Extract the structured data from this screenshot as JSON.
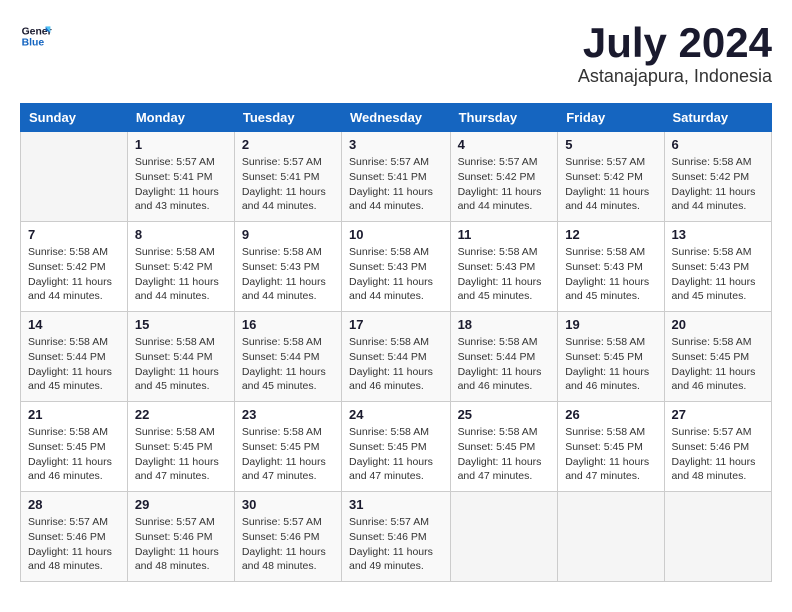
{
  "logo": {
    "line1": "General",
    "line2": "Blue"
  },
  "calendar": {
    "title": "July 2024",
    "subtitle": "Astanajapura, Indonesia"
  },
  "weekdays": [
    "Sunday",
    "Monday",
    "Tuesday",
    "Wednesday",
    "Thursday",
    "Friday",
    "Saturday"
  ],
  "weeks": [
    [
      {
        "day": "",
        "info": ""
      },
      {
        "day": "1",
        "info": "Sunrise: 5:57 AM\nSunset: 5:41 PM\nDaylight: 11 hours\nand 43 minutes."
      },
      {
        "day": "2",
        "info": "Sunrise: 5:57 AM\nSunset: 5:41 PM\nDaylight: 11 hours\nand 44 minutes."
      },
      {
        "day": "3",
        "info": "Sunrise: 5:57 AM\nSunset: 5:41 PM\nDaylight: 11 hours\nand 44 minutes."
      },
      {
        "day": "4",
        "info": "Sunrise: 5:57 AM\nSunset: 5:42 PM\nDaylight: 11 hours\nand 44 minutes."
      },
      {
        "day": "5",
        "info": "Sunrise: 5:57 AM\nSunset: 5:42 PM\nDaylight: 11 hours\nand 44 minutes."
      },
      {
        "day": "6",
        "info": "Sunrise: 5:58 AM\nSunset: 5:42 PM\nDaylight: 11 hours\nand 44 minutes."
      }
    ],
    [
      {
        "day": "7",
        "info": "Sunrise: 5:58 AM\nSunset: 5:42 PM\nDaylight: 11 hours\nand 44 minutes."
      },
      {
        "day": "8",
        "info": "Sunrise: 5:58 AM\nSunset: 5:42 PM\nDaylight: 11 hours\nand 44 minutes."
      },
      {
        "day": "9",
        "info": "Sunrise: 5:58 AM\nSunset: 5:43 PM\nDaylight: 11 hours\nand 44 minutes."
      },
      {
        "day": "10",
        "info": "Sunrise: 5:58 AM\nSunset: 5:43 PM\nDaylight: 11 hours\nand 44 minutes."
      },
      {
        "day": "11",
        "info": "Sunrise: 5:58 AM\nSunset: 5:43 PM\nDaylight: 11 hours\nand 45 minutes."
      },
      {
        "day": "12",
        "info": "Sunrise: 5:58 AM\nSunset: 5:43 PM\nDaylight: 11 hours\nand 45 minutes."
      },
      {
        "day": "13",
        "info": "Sunrise: 5:58 AM\nSunset: 5:43 PM\nDaylight: 11 hours\nand 45 minutes."
      }
    ],
    [
      {
        "day": "14",
        "info": "Sunrise: 5:58 AM\nSunset: 5:44 PM\nDaylight: 11 hours\nand 45 minutes."
      },
      {
        "day": "15",
        "info": "Sunrise: 5:58 AM\nSunset: 5:44 PM\nDaylight: 11 hours\nand 45 minutes."
      },
      {
        "day": "16",
        "info": "Sunrise: 5:58 AM\nSunset: 5:44 PM\nDaylight: 11 hours\nand 45 minutes."
      },
      {
        "day": "17",
        "info": "Sunrise: 5:58 AM\nSunset: 5:44 PM\nDaylight: 11 hours\nand 46 minutes."
      },
      {
        "day": "18",
        "info": "Sunrise: 5:58 AM\nSunset: 5:44 PM\nDaylight: 11 hours\nand 46 minutes."
      },
      {
        "day": "19",
        "info": "Sunrise: 5:58 AM\nSunset: 5:45 PM\nDaylight: 11 hours\nand 46 minutes."
      },
      {
        "day": "20",
        "info": "Sunrise: 5:58 AM\nSunset: 5:45 PM\nDaylight: 11 hours\nand 46 minutes."
      }
    ],
    [
      {
        "day": "21",
        "info": "Sunrise: 5:58 AM\nSunset: 5:45 PM\nDaylight: 11 hours\nand 46 minutes."
      },
      {
        "day": "22",
        "info": "Sunrise: 5:58 AM\nSunset: 5:45 PM\nDaylight: 11 hours\nand 47 minutes."
      },
      {
        "day": "23",
        "info": "Sunrise: 5:58 AM\nSunset: 5:45 PM\nDaylight: 11 hours\nand 47 minutes."
      },
      {
        "day": "24",
        "info": "Sunrise: 5:58 AM\nSunset: 5:45 PM\nDaylight: 11 hours\nand 47 minutes."
      },
      {
        "day": "25",
        "info": "Sunrise: 5:58 AM\nSunset: 5:45 PM\nDaylight: 11 hours\nand 47 minutes."
      },
      {
        "day": "26",
        "info": "Sunrise: 5:58 AM\nSunset: 5:45 PM\nDaylight: 11 hours\nand 47 minutes."
      },
      {
        "day": "27",
        "info": "Sunrise: 5:57 AM\nSunset: 5:46 PM\nDaylight: 11 hours\nand 48 minutes."
      }
    ],
    [
      {
        "day": "28",
        "info": "Sunrise: 5:57 AM\nSunset: 5:46 PM\nDaylight: 11 hours\nand 48 minutes."
      },
      {
        "day": "29",
        "info": "Sunrise: 5:57 AM\nSunset: 5:46 PM\nDaylight: 11 hours\nand 48 minutes."
      },
      {
        "day": "30",
        "info": "Sunrise: 5:57 AM\nSunset: 5:46 PM\nDaylight: 11 hours\nand 48 minutes."
      },
      {
        "day": "31",
        "info": "Sunrise: 5:57 AM\nSunset: 5:46 PM\nDaylight: 11 hours\nand 49 minutes."
      },
      {
        "day": "",
        "info": ""
      },
      {
        "day": "",
        "info": ""
      },
      {
        "day": "",
        "info": ""
      }
    ]
  ]
}
